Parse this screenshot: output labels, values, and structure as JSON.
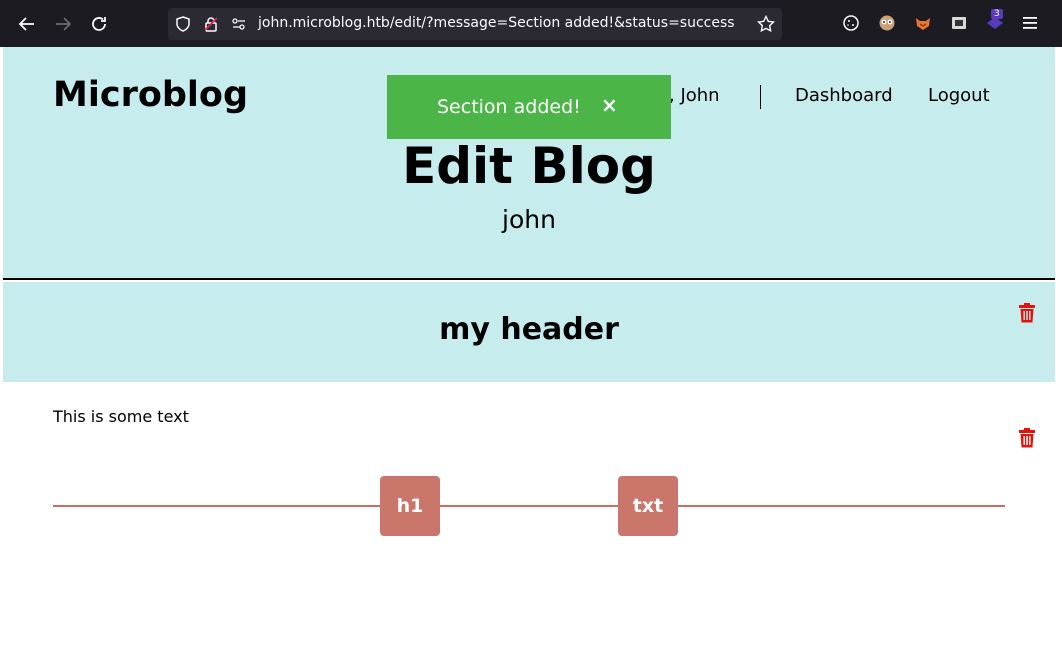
{
  "browser": {
    "url": "john.microblog.htb/edit/?message=Section added!&status=success",
    "extension_badge": "3"
  },
  "header": {
    "brand": "Microblog",
    "greeting": "o, John",
    "nav": {
      "dashboard": "Dashboard",
      "logout": "Logout"
    },
    "title": "Edit Blog",
    "subtitle": "john"
  },
  "toast": {
    "message": "Section added!",
    "close": "×"
  },
  "sections": {
    "h1_text": "my header",
    "txt_text": "This is some text"
  },
  "add_buttons": {
    "h1": "h1",
    "txt": "txt"
  },
  "colors": {
    "hero_bg": "#c7ecee",
    "toast_bg": "#4bb548",
    "add_btn_bg": "#ca766b",
    "trash": "#e0140e"
  }
}
